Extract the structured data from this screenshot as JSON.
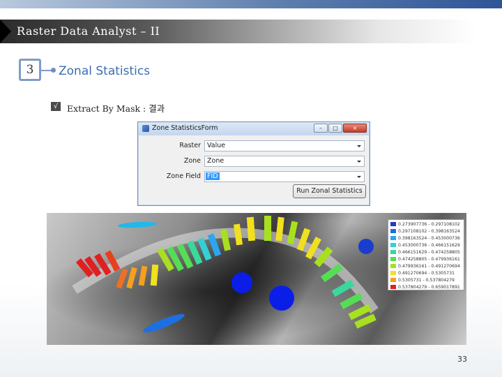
{
  "slide": {
    "title": "Raster Data Analyst – II",
    "section_number": "3",
    "section_title": "Zonal Statistics",
    "bullet_check": "√",
    "bullet_text": "Extract By Mask : 결과",
    "page_number": "33"
  },
  "window": {
    "title": "Zone StatisticsForm",
    "controls": {
      "minimize": "–",
      "maximize": "□",
      "close": "×"
    },
    "fields": [
      {
        "label": "Raster",
        "value": "Value"
      },
      {
        "label": "Zone",
        "value": "Zone"
      },
      {
        "label": "Zone Field",
        "value": "FID"
      }
    ],
    "run_button": "Run Zonal Statistics"
  },
  "legend": [
    {
      "label": "0.273907736 - 0.297108102",
      "color": "#1a3ccf"
    },
    {
      "label": "0.297108102 - 0.398163524",
      "color": "#1e6fe0"
    },
    {
      "label": "0.398163524 - 0.453000736",
      "color": "#2aa7f0"
    },
    {
      "label": "0.453000736 - 0.466151629",
      "color": "#33d0d8"
    },
    {
      "label": "0.466151629 - 0.474258805",
      "color": "#3ad89a"
    },
    {
      "label": "0.474258805 - 0.479936161",
      "color": "#55dd55"
    },
    {
      "label": "0.479936161 - 0.491270694",
      "color": "#a8e020"
    },
    {
      "label": "0.491270694 - 0.5305731",
      "color": "#f0e020"
    },
    {
      "label": "0.5305731 - 0.537804279",
      "color": "#f5a020"
    },
    {
      "label": "0.537804279 - 0.659017891",
      "color": "#e02020"
    }
  ]
}
